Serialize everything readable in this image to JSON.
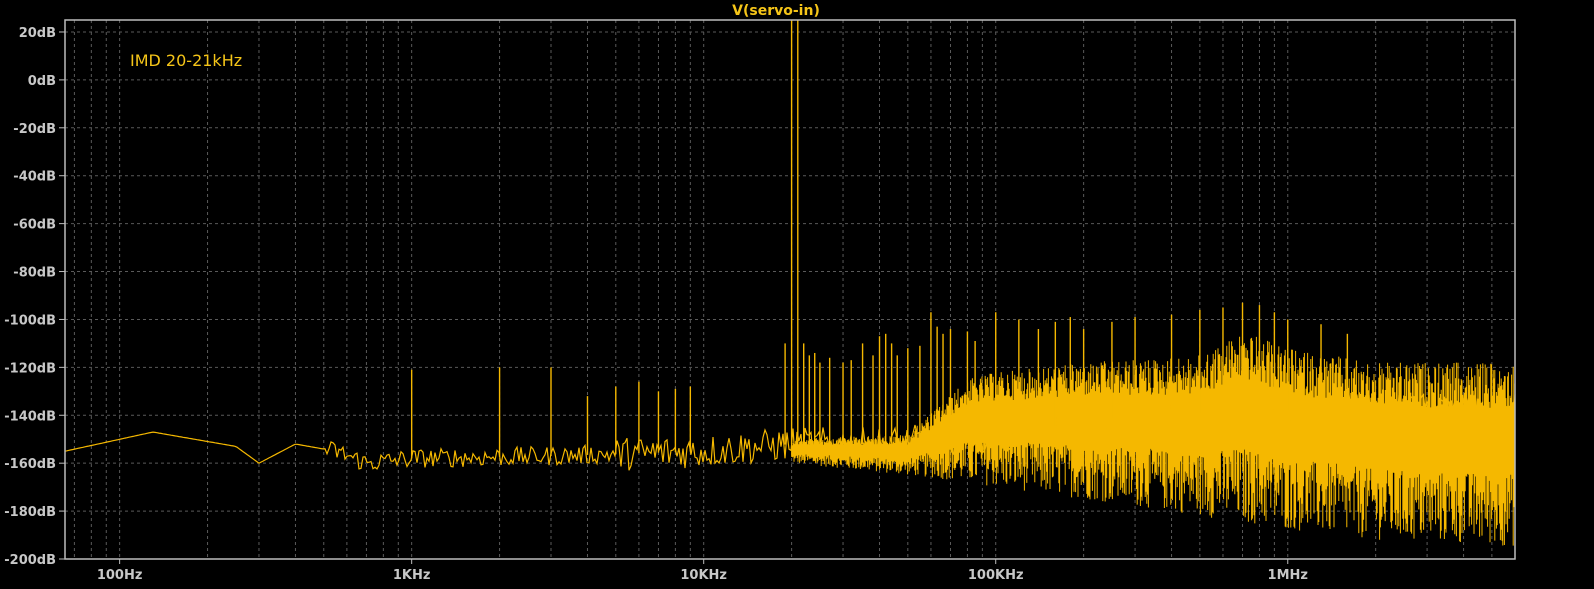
{
  "chart_data": {
    "type": "line",
    "title": "V(servo-in)",
    "annotation": "IMD 20-21kHz",
    "xscale": "log",
    "xlim": [
      65,
      6000000
    ],
    "ylim": [
      -200,
      25
    ],
    "grid": true,
    "xticks": [
      {
        "value": 100,
        "label": "100Hz"
      },
      {
        "value": 1000,
        "label": "1KHz"
      },
      {
        "value": 10000,
        "label": "10KHz"
      },
      {
        "value": 100000,
        "label": "100KHz"
      },
      {
        "value": 1000000,
        "label": "1MHz"
      }
    ],
    "yticks": [
      {
        "value": 20,
        "label": "20dB"
      },
      {
        "value": 0,
        "label": "0dB"
      },
      {
        "value": -20,
        "label": "-20dB"
      },
      {
        "value": -40,
        "label": "-40dB"
      },
      {
        "value": -60,
        "label": "-60dB"
      },
      {
        "value": -80,
        "label": "-80dB"
      },
      {
        "value": -100,
        "label": "-100dB"
      },
      {
        "value": -120,
        "label": "-120dB"
      },
      {
        "value": -140,
        "label": "-140dB"
      },
      {
        "value": -160,
        "label": "-160dB"
      },
      {
        "value": -180,
        "label": "-180dB"
      },
      {
        "value": -200,
        "label": "-200dB"
      }
    ],
    "series": [
      {
        "color": "#f5b800",
        "floor": [
          [
            65,
            -155
          ],
          [
            130,
            -147
          ],
          [
            250,
            -153
          ],
          [
            300,
            -160
          ],
          [
            400,
            -152
          ],
          [
            550,
            -155
          ],
          [
            700,
            -160
          ],
          [
            1000,
            -158
          ],
          [
            3000,
            -157
          ],
          [
            10000,
            -155
          ],
          [
            20000,
            -152
          ],
          [
            40000,
            -152
          ],
          [
            70000,
            -150
          ],
          [
            100000,
            -148
          ],
          [
            300000,
            -140
          ],
          [
            1000000,
            -138
          ],
          [
            6000000,
            -138
          ]
        ],
        "noise_band": [
          [
            20000,
            -160,
            -150
          ],
          [
            50000,
            -165,
            -148
          ],
          [
            80000,
            -168,
            -125
          ],
          [
            100000,
            -170,
            -122
          ],
          [
            200000,
            -175,
            -118
          ],
          [
            500000,
            -182,
            -115
          ],
          [
            700000,
            -185,
            -105
          ],
          [
            1000000,
            -188,
            -112
          ],
          [
            2000000,
            -192,
            -118
          ],
          [
            6000000,
            -195,
            -118
          ]
        ],
        "peaks": [
          [
            20000,
            25
          ],
          [
            21000,
            25
          ],
          [
            1000,
            -121
          ],
          [
            2000,
            -120
          ],
          [
            3000,
            -120
          ],
          [
            4000,
            -132
          ],
          [
            5000,
            -128
          ],
          [
            6000,
            -126
          ],
          [
            7000,
            -130
          ],
          [
            8000,
            -129
          ],
          [
            9000,
            -128
          ],
          [
            19000,
            -110
          ],
          [
            22000,
            -110
          ],
          [
            23000,
            -115
          ],
          [
            24000,
            -114
          ],
          [
            25000,
            -118
          ],
          [
            27000,
            -116
          ],
          [
            30000,
            -118
          ],
          [
            32000,
            -117
          ],
          [
            35000,
            -110
          ],
          [
            38000,
            -115
          ],
          [
            40000,
            -107
          ],
          [
            42000,
            -106
          ],
          [
            44000,
            -110
          ],
          [
            46000,
            -115
          ],
          [
            50000,
            -112
          ],
          [
            55000,
            -111
          ],
          [
            60000,
            -97
          ],
          [
            63000,
            -103
          ],
          [
            66000,
            -106
          ],
          [
            70000,
            -104
          ],
          [
            80000,
            -105
          ],
          [
            85000,
            -109
          ],
          [
            100000,
            -97
          ],
          [
            120000,
            -100
          ],
          [
            140000,
            -104
          ],
          [
            160000,
            -101
          ],
          [
            180000,
            -99
          ],
          [
            200000,
            -104
          ],
          [
            250000,
            -101
          ],
          [
            300000,
            -99
          ],
          [
            400000,
            -98
          ],
          [
            500000,
            -96
          ],
          [
            600000,
            -95
          ],
          [
            700000,
            -93
          ],
          [
            800000,
            -94
          ],
          [
            900000,
            -97
          ],
          [
            1000000,
            -100
          ],
          [
            1300000,
            -102
          ],
          [
            1600000,
            -106
          ]
        ]
      }
    ]
  }
}
